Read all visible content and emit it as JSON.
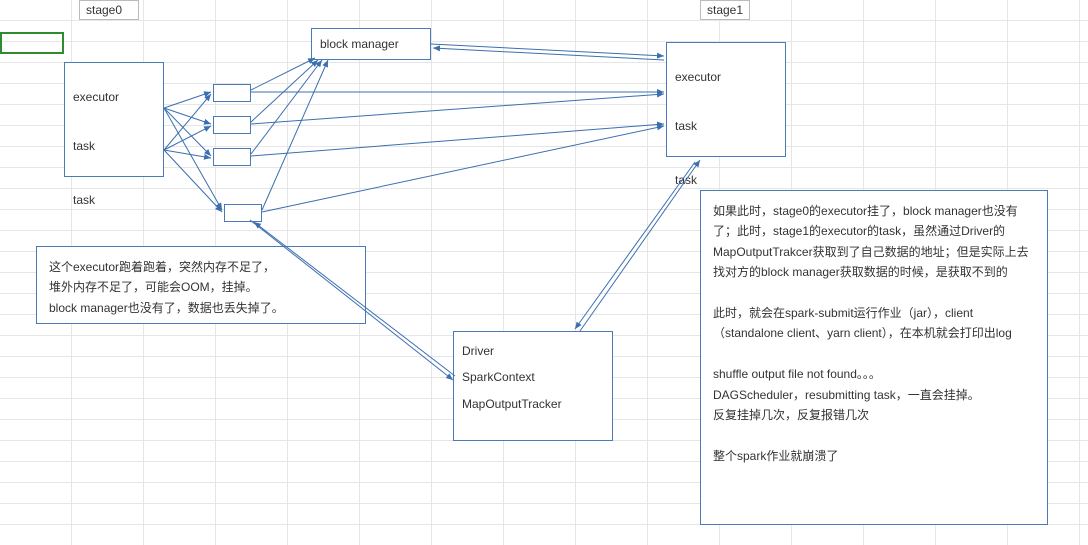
{
  "labels": {
    "stage0": "stage0",
    "stage1": "stage1"
  },
  "executor_left": {
    "title": "executor",
    "task1": "task",
    "task2": "task"
  },
  "executor_right": {
    "title": "executor",
    "task1": "task",
    "task2": "task"
  },
  "block_manager": "block manager",
  "driver": {
    "l1": "Driver",
    "l2": "SparkContext",
    "l3": "MapOutputTracker"
  },
  "note_left": "这个executor跑着跑着，突然内存不足了，\n堆外内存不足了，可能会OOM，挂掉。\nblock manager也没有了，数据也丢失掉了。",
  "note_right": "如果此时，stage0的executor挂了，block manager也没有了；此时，stage1的executor的task，虽然通过Driver的MapOutputTrakcer获取到了自己数据的地址；但是实际上去找对方的block manager获取数据的时候，是获取不到的\n\n此时，就会在spark-submit运行作业（jar），client（standalone client、yarn client），在本机就会打印出log\n\nshuffle output file not found。。。\nDAGScheduler，resubmitting task，一直会挂掉。\n反复挂掉几次，反复报错几次\n\n整个spark作业就崩溃了"
}
